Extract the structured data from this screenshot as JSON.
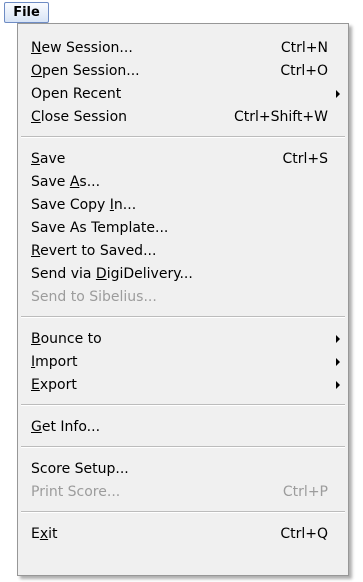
{
  "menu_title": "File",
  "items": [
    {
      "pre": "",
      "key": "N",
      "post": "ew Session...",
      "shortcut": "Ctrl+N"
    },
    {
      "pre": "",
      "key": "O",
      "post": "pen Session...",
      "shortcut": "Ctrl+O"
    },
    {
      "pre": "Open Recent",
      "key": "",
      "post": "",
      "shortcut": ""
    },
    {
      "pre": "",
      "key": "C",
      "post": "lose Session",
      "shortcut": "Ctrl+Shift+W"
    },
    {
      "pre": "",
      "key": "S",
      "post": "ave",
      "shortcut": "Ctrl+S"
    },
    {
      "pre": "Save ",
      "key": "A",
      "post": "s...",
      "shortcut": ""
    },
    {
      "pre": "Save Copy ",
      "key": "I",
      "post": "n...",
      "shortcut": ""
    },
    {
      "pre": "Save As Template...",
      "key": "",
      "post": "",
      "shortcut": ""
    },
    {
      "pre": "",
      "key": "R",
      "post": "evert to Saved...",
      "shortcut": ""
    },
    {
      "pre": "Send via ",
      "key": "D",
      "post": "igiDelivery...",
      "shortcut": ""
    },
    {
      "pre": "Send to Sibelius...",
      "key": "",
      "post": "",
      "shortcut": ""
    },
    {
      "pre": "",
      "key": "B",
      "post": "ounce to",
      "shortcut": ""
    },
    {
      "pre": "",
      "key": "I",
      "post": "mport",
      "shortcut": ""
    },
    {
      "pre": "",
      "key": "E",
      "post": "xport",
      "shortcut": ""
    },
    {
      "pre": "",
      "key": "G",
      "post": "et Info...",
      "shortcut": ""
    },
    {
      "pre": "Score Setup...",
      "key": "",
      "post": "",
      "shortcut": ""
    },
    {
      "pre": "Print Score...",
      "key": "",
      "post": "",
      "shortcut": "Ctrl+P"
    },
    {
      "pre": "E",
      "key": "x",
      "post": "it",
      "shortcut": "Ctrl+Q"
    }
  ],
  "colors": {
    "menu_bg": "#f0f0f0",
    "disabled_text": "#9c9c9c",
    "separator": "#bcbcbc"
  }
}
